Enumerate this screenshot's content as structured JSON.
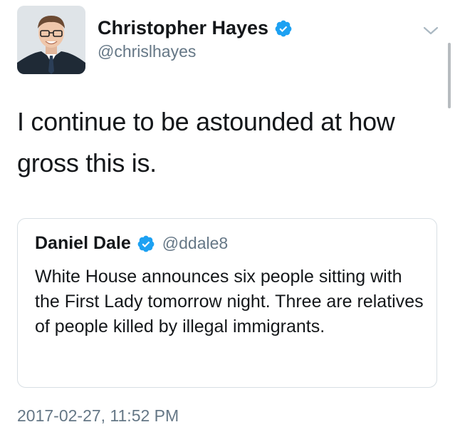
{
  "author": {
    "name": "Christopher Hayes",
    "handle": "@chrislhayes",
    "verified": true,
    "avatar_icon": "profile-photo"
  },
  "tweet": {
    "text": "I continue to be astounded at how gross this is.",
    "timestamp": "2017-02-27, 11:52 PM"
  },
  "quoted_tweet": {
    "name": "Daniel Dale",
    "handle": "@ddale8",
    "verified": true,
    "text": "White House announces six people sitting with the First Lady tomorrow night. Three are relatives of people killed by illegal immigrants."
  },
  "icons": {
    "verified": "verified-badge-icon",
    "menu": "chevron-down-icon"
  },
  "colors": {
    "verified_blue": "#1da1f2",
    "secondary_text": "#657786",
    "border": "#d8dfe4"
  }
}
